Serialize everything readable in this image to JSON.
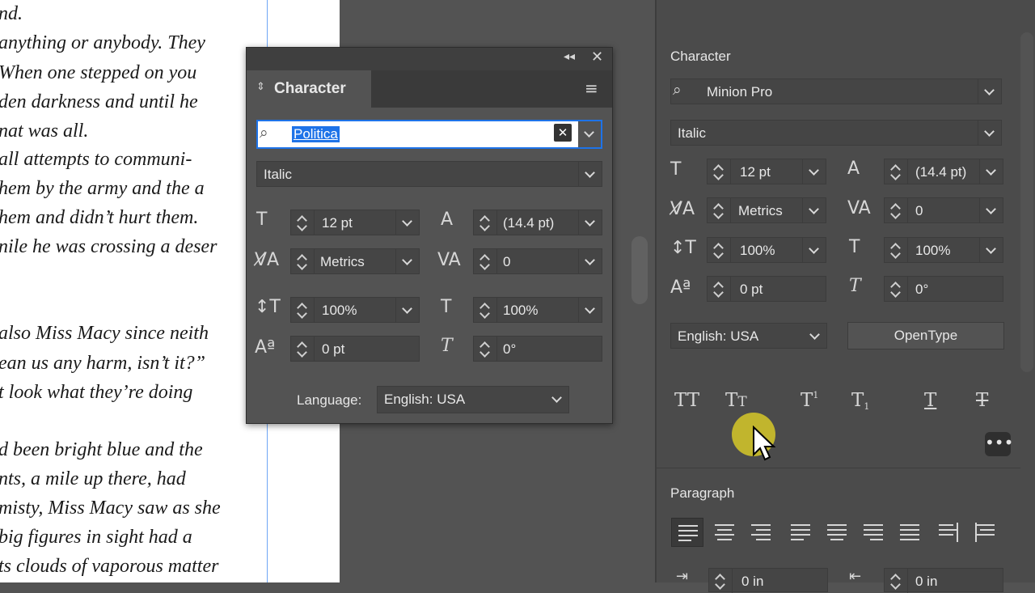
{
  "document": {
    "lines": [
      "nd.",
      "anything or anybody. They",
      "When one stepped on you",
      "den darkness and until he",
      "nat was all.",
      "all attempts to communi-",
      "hem by the army and the a",
      "hem and didn’t hurt them.",
      "nile he was crossing a deser",
      "also Miss Macy since neith",
      "ean us any harm, isn’t it?”",
      "t look what they’re doing",
      "d been bright blue and the",
      "nts, a mile up there, had",
      "misty, Miss Macy saw as she",
      "big figures in sight had a",
      "ts clouds of vaporous matter"
    ]
  },
  "floating_panel": {
    "tab_title": "Character",
    "font_family": "Politica",
    "font_style": "Italic",
    "font_size": "12 pt",
    "leading": "(14.4 pt)",
    "kerning": "Metrics",
    "tracking": "0",
    "vertical_scale": "100%",
    "horizontal_scale": "100%",
    "baseline_shift": "0 pt",
    "skew": "0°",
    "language_label": "Language:",
    "language_value": "English: USA"
  },
  "right_panel": {
    "character_header": "Character",
    "font_family": "Minion Pro",
    "font_style": "Italic",
    "font_size": "12 pt",
    "leading": "(14.4 pt)",
    "kerning": "Metrics",
    "tracking": "0",
    "vertical_scale": "100%",
    "horizontal_scale": "100%",
    "baseline_shift": "0 pt",
    "skew": "0°",
    "language_value": "English: USA",
    "opentype_button": "OpenType",
    "paragraph_header": "Paragraph",
    "indent_left": "0 in",
    "indent_right": "0 in"
  },
  "colors": {
    "panel_bg": "#535353",
    "highlight": "#1e73e8",
    "cursor_halo": "#d6c828"
  },
  "icons": [
    "search-icon",
    "clear-icon",
    "panel-menu-icon",
    "collapse-icon",
    "close-icon",
    "font-size-icon",
    "leading-icon",
    "kerning-icon",
    "tracking-icon",
    "vertical-scale-icon",
    "horizontal-scale-icon",
    "baseline-shift-icon",
    "skew-icon",
    "more-icon",
    "mouse-pointer-icon"
  ]
}
